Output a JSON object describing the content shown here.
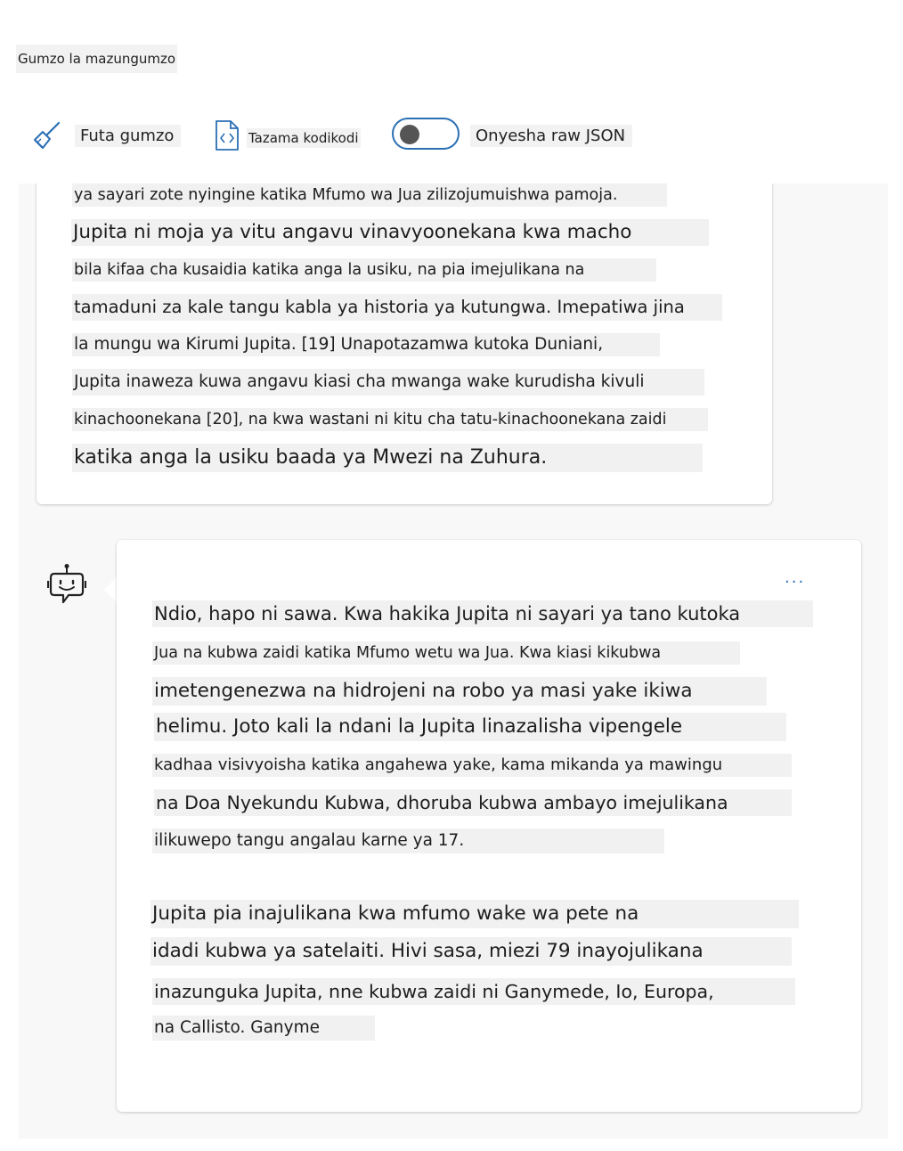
{
  "header": {
    "title": "Gumzo la mazungumzo"
  },
  "toolbar": {
    "clear_label": "Futa gumzo",
    "view_code_label": "Tazama kodikodi",
    "raw_json_label": "Onyesha raw JSON",
    "raw_json_enabled": false
  },
  "icons": {
    "clear": "broom-icon",
    "code": "code-file-icon",
    "bot": "bot-icon",
    "more": "more-icon"
  },
  "colors": {
    "accent": "#2a6fb4",
    "highlight": "#f1f1f1",
    "panel": "#f8f8f8"
  },
  "user_message": {
    "lines": [
      "ya sayari zote nyingine katika Mfumo wa Jua zilizojumuishwa pamoja.",
      "Jupita ni moja ya vitu angavu vinavyoonekana kwa macho",
      "bila kifaa cha kusaidia katika anga la usiku, na pia imejulikana na",
      "tamaduni za kale tangu kabla ya historia ya kutungwa. Imepatiwa jina",
      "la mungu wa Kirumi Jupita. [19] Unapotazamwa kutoka Duniani,",
      "Jupita inaweza kuwa angavu kiasi cha mwanga wake kurudisha kivuli",
      "kinachoonekana [20], na kwa wastani ni kitu cha tatu-kinachoonekana zaidi",
      "katika anga la usiku baada ya Mwezi na Zuhura."
    ]
  },
  "bot_message": {
    "more_label": "...",
    "paragraph1": [
      "Ndio, hapo ni sawa. Kwa hakika Jupita ni sayari ya tano kutoka",
      "Jua na kubwa zaidi katika Mfumo wetu wa Jua. Kwa kiasi kikubwa",
      "imetengenezwa na hidrojeni na robo ya masi yake ikiwa",
      "helimu. Joto kali la ndani la Jupita linazalisha vipengele",
      "kadhaa visivyoisha katika angahewa yake, kama mikanda ya mawingu",
      "na Doa Nyekundu Kubwa, dhoruba kubwa ambayo imejulikana",
      "ilikuwepo tangu angalau karne ya 17."
    ],
    "paragraph2": [
      "Jupita pia inajulikana kwa mfumo wake wa pete na",
      "idadi kubwa ya satelaiti. Hivi sasa, miezi 79 inayojulikana",
      "inazunguka Jupita, nne kubwa zaidi ni Ganymede, Io, Europa,",
      "na Callisto. Ganyme"
    ]
  }
}
